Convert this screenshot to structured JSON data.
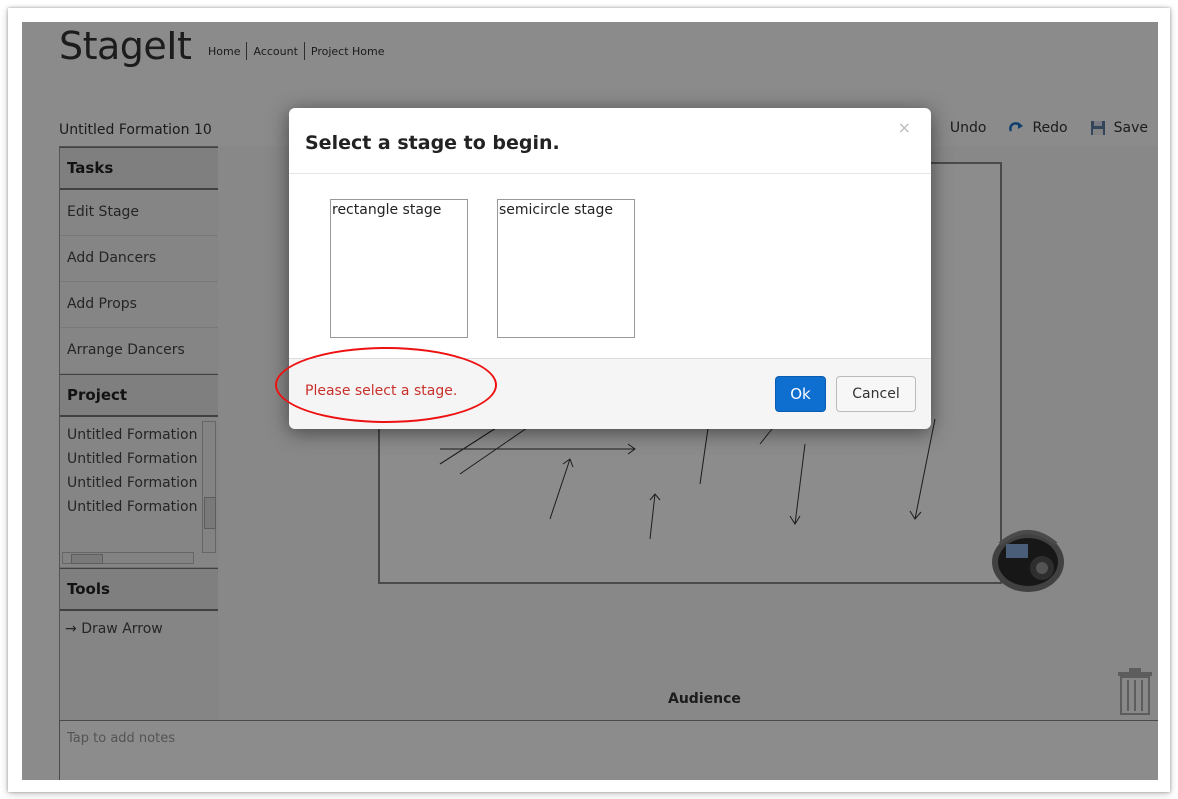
{
  "app": {
    "logo": "StageIt",
    "nav": [
      "Home",
      "Account",
      "Project Home"
    ],
    "formation_title": "Untitled Formation 10"
  },
  "toolbar": {
    "undo_label": "Undo",
    "redo_label": "Redo",
    "save_label": "Save"
  },
  "sidebar": {
    "tasks_header": "Tasks",
    "tasks": [
      "Edit Stage",
      "Add Dancers",
      "Add Props",
      "Arrange Dancers"
    ],
    "project_header": "Project",
    "project_items": [
      "Untitled Formation",
      "Untitled Formation",
      "Untitled Formation",
      "Untitled Formation"
    ],
    "tools_header": "Tools",
    "tools": [
      "Draw Arrow"
    ]
  },
  "stage": {
    "audience_label": "Audience"
  },
  "notes": {
    "placeholder": "Tap to add notes"
  },
  "modal": {
    "title": "Select a stage to begin.",
    "close_glyph": "×",
    "options": [
      "rectangle stage",
      "semicircle stage"
    ],
    "error": "Please select a stage.",
    "ok_label": "Ok",
    "cancel_label": "Cancel"
  },
  "colors": {
    "error": "#c9302c",
    "primary_button": "#0e6fd1",
    "annotation": "#ee1111"
  }
}
